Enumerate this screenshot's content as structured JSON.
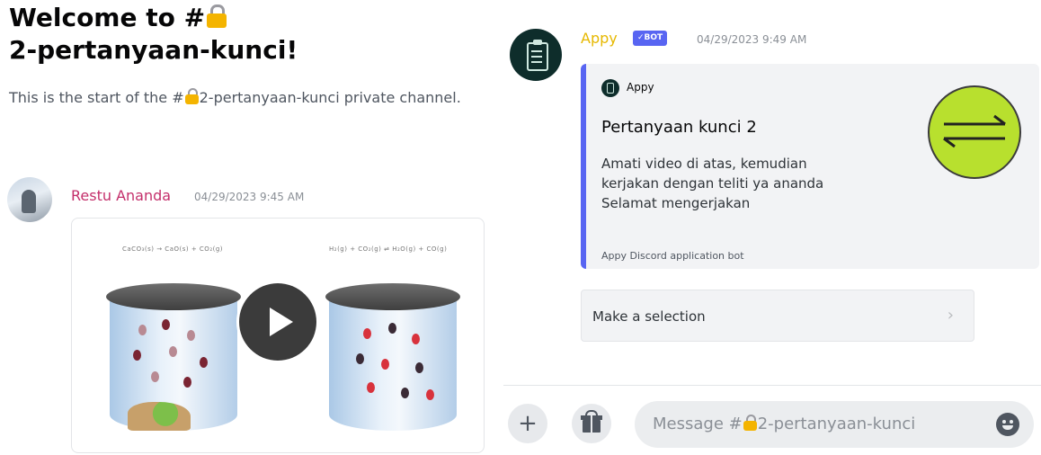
{
  "channel_intro": {
    "title_prefix": "Welcome to #",
    "title_channel": "2-pertanyaan-kunci!",
    "description_pre": "This is the start of the #",
    "description_channel": "2-pertanyaan-kunci",
    "description_post": " private channel."
  },
  "messages": [
    {
      "author": "Restu Ananda",
      "timestamp": "04/29/2023 9:45 AM",
      "attachment": {
        "type": "video",
        "left_equation": "CaCO₃(s) → CaO(s) + CO₂(g)",
        "right_equation": "H₂(g) + CO₂(g) ⇌ H₂O(g) + CO(g)"
      }
    },
    {
      "author": "Appy",
      "author_color": "#e6b800",
      "badge": "✓BOT",
      "timestamp": "04/29/2023 9:49 AM",
      "embed": {
        "accent_color": "#5865f2",
        "author": "Appy",
        "title": "Pertanyaan kunci 2",
        "description": [
          "Amati video di atas, kemudian",
          "kerjakan dengan teliti ya ananda",
          "Selamat mengerjakan"
        ],
        "footer": "Appy Discord application bot",
        "thumbnail_icon": "equilibrium-arrows-icon"
      },
      "select_menu": {
        "placeholder": "Make a selection",
        "icon": "chevron-right-icon"
      }
    }
  ],
  "composer": {
    "placeholder_prefix": "Message #",
    "placeholder_channel": "2-pertanyaan-kunci",
    "add_icon": "plus-icon",
    "gift_icon": "gift-icon",
    "emoji_icon": "emoji-icon"
  }
}
